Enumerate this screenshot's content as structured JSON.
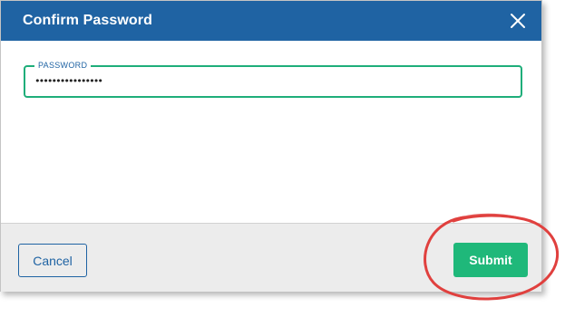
{
  "dialog": {
    "title": "Confirm Password",
    "close_icon": "close-icon"
  },
  "password_field": {
    "label": "PASSWORD",
    "value": "••••••••••••••••"
  },
  "footer": {
    "cancel_label": "Cancel",
    "submit_label": "Submit"
  },
  "colors": {
    "header": "#1f63a3",
    "focus_border": "#1fae7a",
    "submit_button": "#1fb87a",
    "annotation": "#e0403e"
  }
}
